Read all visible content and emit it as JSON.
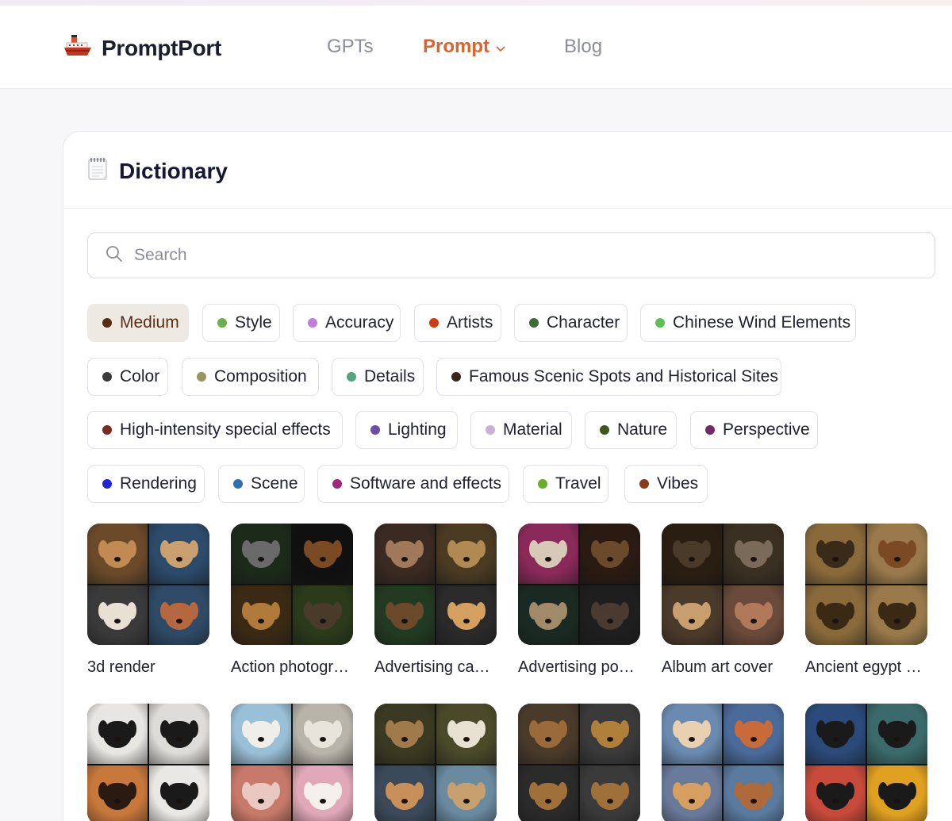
{
  "brand": {
    "name": "PromptPort",
    "logo_icon": "ship-icon"
  },
  "nav": {
    "gpts": "GPTs",
    "prompt": "Prompt",
    "blog": "Blog"
  },
  "dictionary": {
    "title": "Dictionary",
    "title_icon": "notepad-icon",
    "search_placeholder": "Search"
  },
  "categories": [
    {
      "label": "Medium",
      "color": "#5b2d10",
      "active": true
    },
    {
      "label": "Style",
      "color": "#6ab04c"
    },
    {
      "label": "Accuracy",
      "color": "#c27ce0"
    },
    {
      "label": "Artists",
      "color": "#d03a10"
    },
    {
      "label": "Character",
      "color": "#3e6b33"
    },
    {
      "label": "Chinese Wind Elements",
      "color": "#5cbf55"
    },
    {
      "label": "Color",
      "color": "#3b3b3b"
    },
    {
      "label": "Composition",
      "color": "#9a9560"
    },
    {
      "label": "Details",
      "color": "#4ea77a"
    },
    {
      "label": "Famous Scenic Spots and Historical Sites",
      "color": "#3a2519"
    },
    {
      "label": "High-intensity special effects",
      "color": "#7a2a22"
    },
    {
      "label": "Lighting",
      "color": "#6a4fa8"
    },
    {
      "label": "Material",
      "color": "#c7b3d6"
    },
    {
      "label": "Nature",
      "color": "#42561a"
    },
    {
      "label": "Perspective",
      "color": "#742a6a"
    },
    {
      "label": "Rendering",
      "color": "#2424d8"
    },
    {
      "label": "Scene",
      "color": "#2f6fb0"
    },
    {
      "label": "Software and effects",
      "color": "#a0287a"
    },
    {
      "label": "Travel",
      "color": "#6aae2a"
    },
    {
      "label": "Vibes",
      "color": "#8a3a18"
    }
  ],
  "cards": [
    {
      "label": "3d render"
    },
    {
      "label": "Action photography"
    },
    {
      "label": "Advertising campaign"
    },
    {
      "label": "Advertising poster"
    },
    {
      "label": "Album art cover"
    },
    {
      "label": "Ancient egypt papyrus"
    },
    {
      "label": ""
    },
    {
      "label": ""
    },
    {
      "label": ""
    },
    {
      "label": ""
    },
    {
      "label": ""
    },
    {
      "label": ""
    }
  ]
}
